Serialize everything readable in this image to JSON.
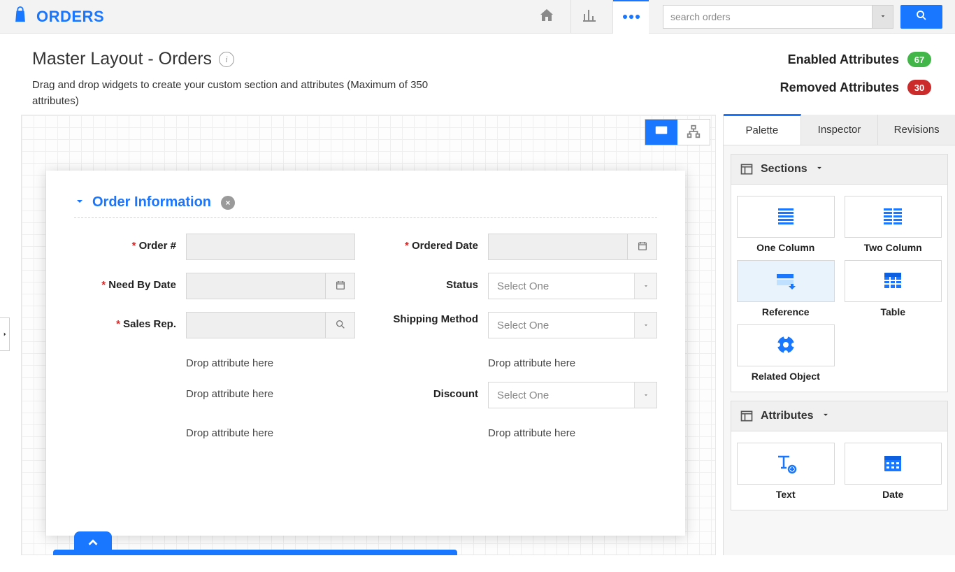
{
  "brand_label": "ORDERS",
  "search": {
    "placeholder": "search orders"
  },
  "page": {
    "title": "Master Layout - Orders",
    "description": "Drag and drop widgets to create your custom section and attributes (Maximum of 350 attributes)"
  },
  "stats": {
    "enabled_label": "Enabled Attributes",
    "enabled_count": "67",
    "removed_label": "Removed Attributes",
    "removed_count": "30"
  },
  "section": {
    "title": "Order Information"
  },
  "fields": {
    "order_no": {
      "label": "Order #"
    },
    "ordered_date": {
      "label": "Ordered Date"
    },
    "need_by": {
      "label": "Need By Date"
    },
    "status": {
      "label": "Status",
      "placeholder": "Select One"
    },
    "sales_rep": {
      "label": "Sales Rep."
    },
    "shipping": {
      "label": "Shipping Method",
      "placeholder": "Select One"
    },
    "discount": {
      "label": "Discount",
      "placeholder": "Select One"
    },
    "drop_text": "Drop attribute here"
  },
  "tabs": {
    "palette": "Palette",
    "inspector": "Inspector",
    "revisions": "Revisions"
  },
  "groups": {
    "sections": {
      "title": "Sections",
      "items": {
        "one_col": "One Column",
        "two_col": "Two Column",
        "reference": "Reference",
        "table": "Table",
        "related": "Related Object"
      }
    },
    "attributes": {
      "title": "Attributes",
      "items": {
        "text": "Text",
        "date": "Date"
      }
    }
  }
}
